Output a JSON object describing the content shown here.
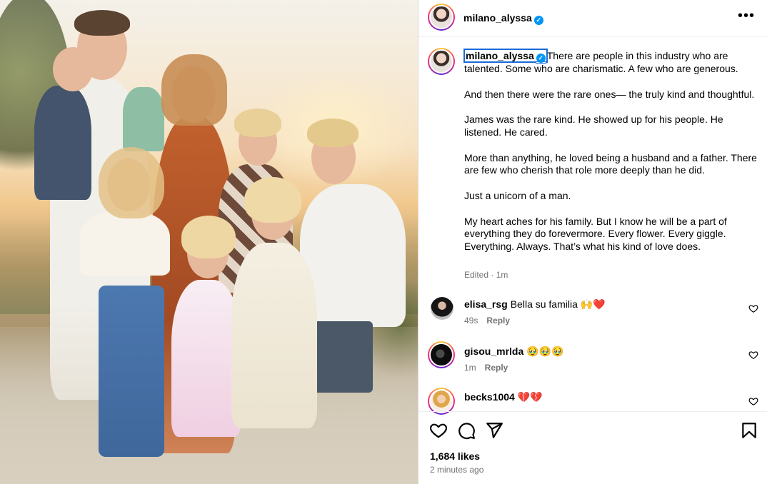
{
  "post": {
    "username": "milano_alyssa",
    "verified_mark": "✓",
    "more_label": "•••",
    "photo_icon": "family-photo",
    "caption": {
      "author": "milano_alyssa",
      "paragraphs": [
        "There are people in this industry who are talented. Some who are charismatic. A few who are generous.",
        "And then there were the rare ones— the truly kind and thoughtful.",
        "James was the rare kind. He showed up for his people. He listened. He cared.",
        "More than anything, he loved being a husband and a father. There are few who cherish that role more deeply than he did.",
        "Just a unicorn of a man.",
        "My heart aches for his family. But I know he will be a part of everything they do forevermore. Every flower. Every giggle. Everything. Always. That’s what his kind of love does."
      ],
      "edited": "Edited · 1m"
    },
    "comments": [
      {
        "user": "elisa_rsg",
        "text": "Bella su familia 🙌❤️",
        "time": "49s",
        "reply": "Reply"
      },
      {
        "user": "gisou_mrlda",
        "text": "🥹🥹🥹",
        "time": "1m",
        "reply": "Reply"
      },
      {
        "user": "becks1004",
        "text": "💔💔",
        "time": "",
        "reply": ""
      }
    ],
    "likes": "1,684 likes",
    "posted": "2 minutes ago"
  },
  "icons": {
    "like": "heart-icon",
    "comment": "comment-icon",
    "share": "share-icon",
    "save": "bookmark-icon"
  },
  "colors": {
    "verified": "#0095f6",
    "secondary_text": "#737373",
    "border": "#dbdbdb"
  }
}
